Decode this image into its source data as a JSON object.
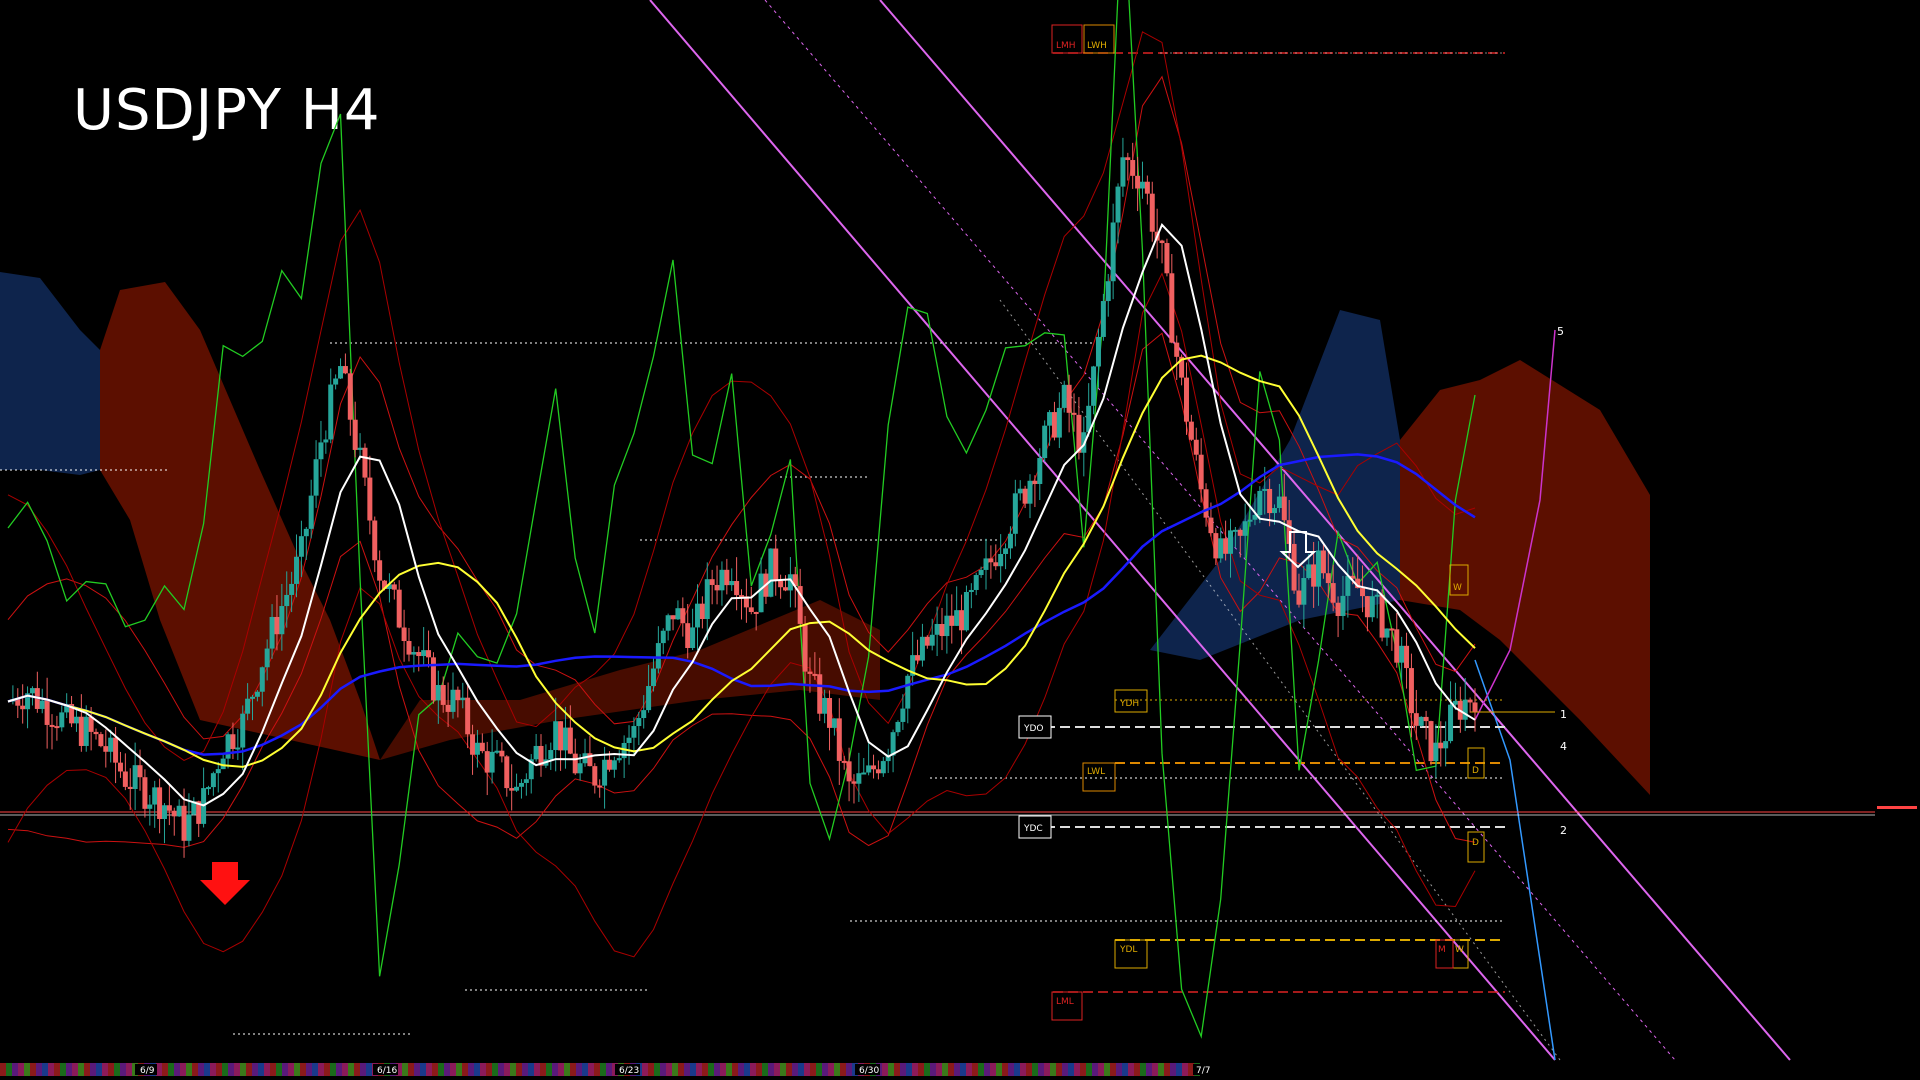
{
  "chart_title": "USDJPY H4",
  "colors": {
    "background": "#000000",
    "bull_candle": "#26a69a",
    "bear_candle": "#f06060",
    "cloud_bear": "#cc2200",
    "cloud_bull": "#1f4fa8",
    "ma_white": "#ffffff",
    "ma_yellow": "#ffff33",
    "ma_blue": "#1a1aff",
    "channel": "#dd66ee",
    "oscillator": "#22cc22"
  },
  "icons": {
    "sell_arrow": "red-down-arrow-icon",
    "down_arrow": "white-down-arrow-icon"
  },
  "level_tags": {
    "lmh": "LMH",
    "lwh": "LWH",
    "ydh": "YDH",
    "ydo": "YDO",
    "lwl": "LWL",
    "ydc": "YDC",
    "ydl": "YDL",
    "lml": "LML",
    "d_upper": "D",
    "d_lower": "D",
    "w_upper": "W",
    "w_lower": "W",
    "m": "M"
  },
  "right_numbers": {
    "n5": "5",
    "n1": "1",
    "n4": "4",
    "n2": "2"
  },
  "chart_data": {
    "type": "candlestick",
    "title": "USDJPY H4",
    "x_dates": [
      "6/9",
      "6/16",
      "6/23",
      "6/30",
      "7/7"
    ],
    "y_scale_labels_visible": false,
    "grid": false,
    "series": [
      {
        "name": "",
        "values": [
          34.2,
          35.4,
          33.6,
          32.0,
          31.1,
          29.4,
          26.5,
          25.1,
          23.8,
          21.3,
          24.0,
          29.8,
          32.0,
          38.5,
          44.0,
          49.2,
          61.0,
          68.5,
          58.6,
          47.6,
          42.9,
          38.9,
          35.0,
          34.0,
          29.0,
          27.7,
          25.0,
          29.0,
          31.5,
          27.6,
          26.6,
          29.6,
          31.0,
          37.6,
          43.5,
          41.0,
          46.5,
          48.2,
          43.8,
          47.9,
          47.0,
          36.0,
          32.5,
          25.2,
          26.5,
          30.0,
          36.8,
          40.0,
          42.0,
          43.5,
          47.5,
          51.9,
          56.0,
          61.0,
          65.0,
          60.1,
          75.0,
          90.0,
          87.9,
          79.5,
          66.4,
          55.8,
          49.1,
          50.5,
          56.4,
          54.6,
          45.1,
          48.4,
          44.9,
          45.8,
          43.3,
          40.0,
          32.0,
          28.9,
          33.3,
          35.1
        ]
      }
    ]
  }
}
